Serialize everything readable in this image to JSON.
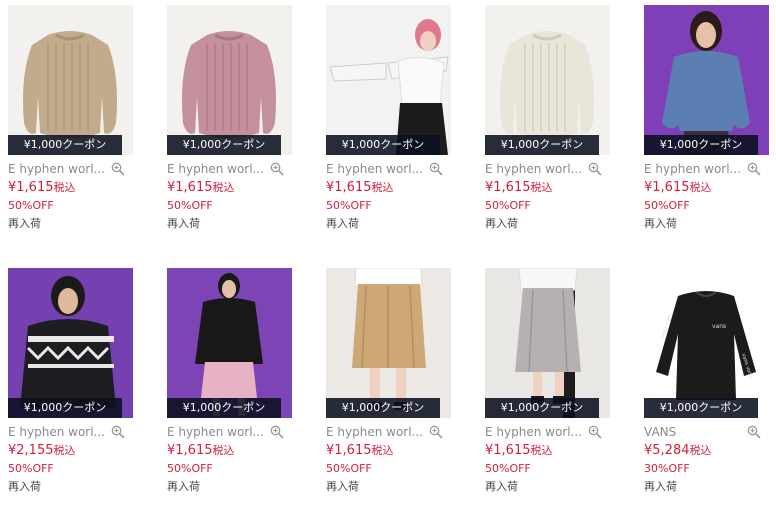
{
  "products": [
    {
      "coupon": "¥1,000クーポン",
      "brand": "E hyphen worl...",
      "price": "¥1,615",
      "tax": "税込",
      "discount": "50%OFF",
      "status": "再入荷",
      "image": "beige-cable-knit-sweater",
      "bg": "#f3f1ee"
    },
    {
      "coupon": "¥1,000クーポン",
      "brand": "E hyphen worl...",
      "price": "¥1,615",
      "tax": "税込",
      "discount": "50%OFF",
      "status": "再入荷",
      "image": "pink-cable-knit-sweater",
      "bg": "#f3f1ee"
    },
    {
      "coupon": "¥1,000クーポン",
      "brand": "E hyphen worl...",
      "price": "¥1,615",
      "tax": "税込",
      "discount": "50%OFF",
      "status": "再入荷",
      "image": "model-white-sweater",
      "bg": "#f2f2f2"
    },
    {
      "coupon": "¥1,000クーポン",
      "brand": "E hyphen worl...",
      "price": "¥1,615",
      "tax": "税込",
      "discount": "50%OFF",
      "status": "再入荷",
      "image": "ivory-cable-knit-sweater",
      "bg": "#f3f1ee"
    },
    {
      "coupon": "¥1,000クーポン",
      "brand": "E hyphen worl...",
      "price": "¥1,615",
      "tax": "税込",
      "discount": "50%OFF",
      "status": "再入荷",
      "image": "model-blue-sweater",
      "bg": "#7f3fb9"
    },
    {
      "coupon": "¥1,000クーポン",
      "brand": "E hyphen worl...",
      "price": "¥2,155",
      "tax": "税込",
      "discount": "50%OFF",
      "status": "再入荷",
      "image": "model-nordic-sweater",
      "bg": "#7540b0"
    },
    {
      "coupon": "¥1,000クーポン",
      "brand": "E hyphen worl...",
      "price": "¥1,615",
      "tax": "税込",
      "discount": "50%OFF",
      "status": "再入荷",
      "image": "model-black-sweater-pink-skirt",
      "bg": "#7d44b6"
    },
    {
      "coupon": "¥1,000クーポン",
      "brand": "E hyphen worl...",
      "price": "¥1,615",
      "tax": "税込",
      "discount": "50%OFF",
      "status": "再入荷",
      "image": "camel-corduroy-skirt",
      "bg": "#ece9e4"
    },
    {
      "coupon": "¥1,000クーポン",
      "brand": "E hyphen worl...",
      "price": "¥1,615",
      "tax": "税込",
      "discount": "50%OFF",
      "status": "再入荷",
      "image": "grey-corduroy-skirt",
      "bg": "#e9e7e4"
    },
    {
      "coupon": "¥1,000クーポン",
      "brand": "VANS",
      "price": "¥5,284",
      "tax": "税込",
      "discount": "30%OFF",
      "status": "再入荷",
      "image": "black-vans-long-sleeve-tee",
      "bg": "#ffffff"
    }
  ],
  "colors": {
    "price": "#d21f3b",
    "brand": "#8a8a8a",
    "coupon_bg": "#0a1020"
  },
  "icons": {
    "zoom": "magnifier-plus-icon"
  }
}
